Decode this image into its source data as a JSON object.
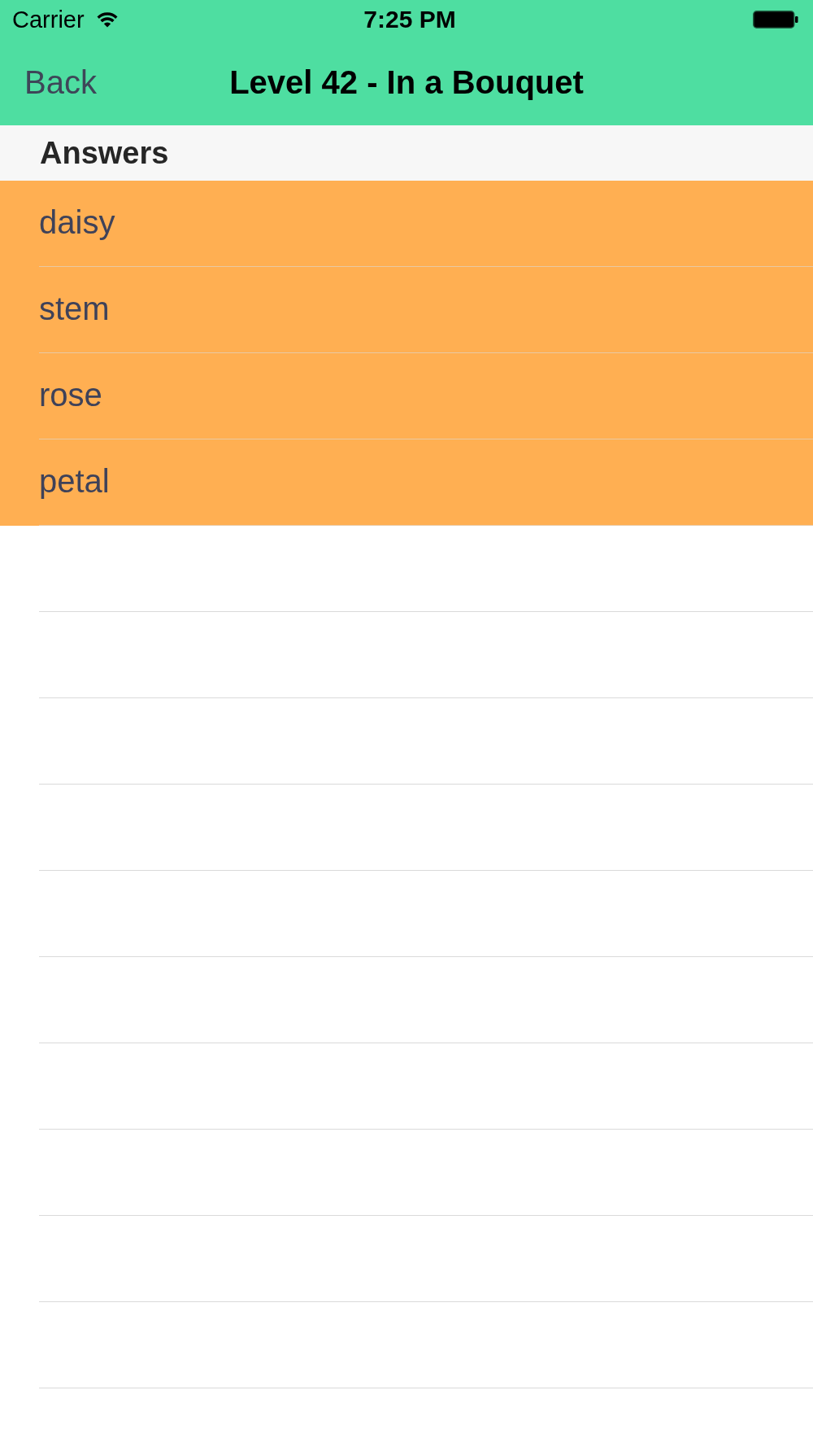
{
  "status_bar": {
    "carrier": "Carrier",
    "time": "7:25 PM"
  },
  "nav_bar": {
    "back": "Back",
    "title": "Level 42 - In a Bouquet"
  },
  "section": {
    "title": "Answers"
  },
  "answers": [
    {
      "text": "daisy",
      "highlighted": true
    },
    {
      "text": "stem",
      "highlighted": true
    },
    {
      "text": "rose",
      "highlighted": true
    },
    {
      "text": "petal",
      "highlighted": true
    }
  ]
}
